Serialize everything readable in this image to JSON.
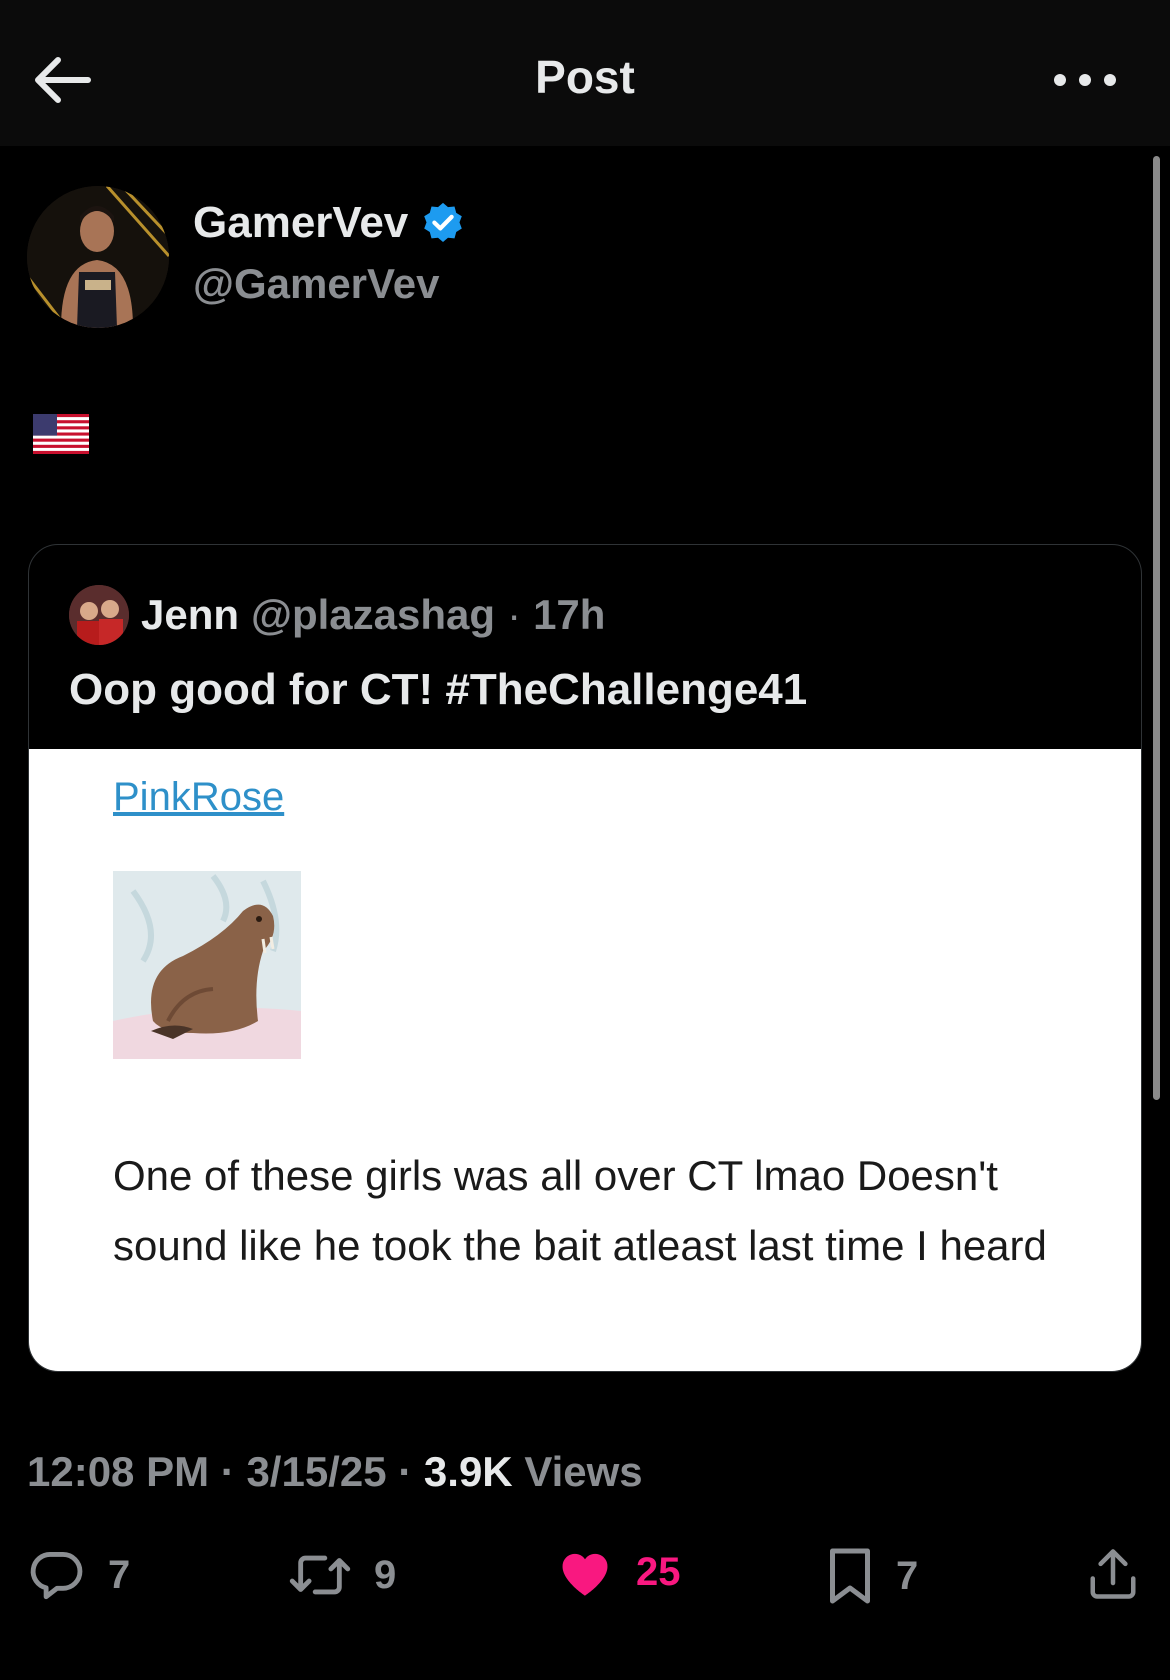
{
  "header": {
    "title": "Post",
    "back_icon": "arrow-left-icon",
    "more_icon": "ellipsis-icon"
  },
  "post": {
    "author_name": "GamerVev",
    "author_handle": "@GamerVev",
    "verified": true,
    "verified_color": "#1d9bf0",
    "text_emoji": "us-flag-icon"
  },
  "quote": {
    "author_name": "Jenn",
    "author_handle": "@plazashag",
    "separator": "·",
    "time": "17h",
    "text": "Oop good for CT! #TheChallenge41",
    "media": {
      "link_text": "PinkRose",
      "image": "walrus-image",
      "body": "One of these girls was all over CT lmao Doesn't sound like he took the bait atleast last time I heard"
    }
  },
  "meta": {
    "time": "12:08 PM",
    "sep1": "·",
    "date": "3/15/25",
    "sep2": "·",
    "views_count": "3.9K",
    "views_label": "Views"
  },
  "actions": {
    "replies": "7",
    "reposts": "9",
    "likes": "25",
    "bookmarks": "7",
    "like_color": "#f91880"
  }
}
